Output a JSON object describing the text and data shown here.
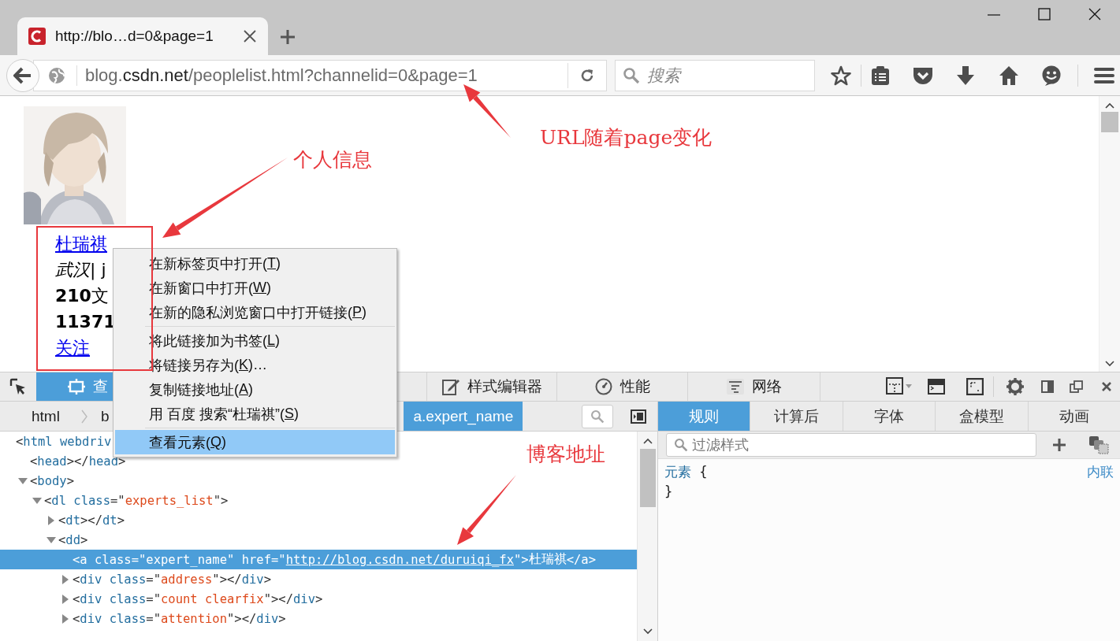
{
  "browser": {
    "tab": {
      "title": "http://blo…d=0&page=1",
      "selected": true
    },
    "address_bar": {
      "subdomain": "blog.",
      "domain": "csdn.net",
      "path": "/peoplelist.html?channelid=0&page=1"
    },
    "search": {
      "placeholder": "搜索"
    }
  },
  "page": {
    "profile": {
      "name": "杜瑞祺",
      "location": "*武汉*| j",
      "articles": "**210**文",
      "visits": "11371",
      "follow": "关注"
    }
  },
  "devtools": {
    "tabs": [
      {
        "label": "查",
        "kind": "inspector",
        "selected": true
      },
      {
        "label": "样式编辑器",
        "kind": "style-editor",
        "selected": false
      },
      {
        "label": "性能",
        "kind": "performance",
        "selected": false
      },
      {
        "label": "网络",
        "kind": "network",
        "selected": false
      }
    ],
    "breadcrumbs": [
      {
        "label": "html",
        "selected": false
      },
      {
        "label": "b",
        "selected": false
      },
      {
        "label": "a.expert_name",
        "selected": true
      }
    ],
    "markup_tree": [
      {
        "segments": [
          {
            "kind": "punct",
            "t": "<"
          },
          {
            "kind": "tag",
            "t": "html"
          },
          {
            "kind": "attr",
            "t": " webdriv"
          }
        ],
        "selected": false,
        "children": [
          {
            "segments": [
              {
                "kind": "punct",
                "t": "<"
              },
              {
                "kind": "tag",
                "t": "head"
              },
              {
                "kind": "punct",
                "t": "></"
              },
              {
                "kind": "tag",
                "t": "head"
              },
              {
                "kind": "punct",
                "t": ">"
              }
            ],
            "selected": false
          },
          {
            "segments": [
              {
                "kind": "punct",
                "t": "<"
              },
              {
                "kind": "tag",
                "t": "body"
              },
              {
                "kind": "punct",
                "t": ">"
              }
            ],
            "selected": false,
            "expanded": true,
            "children": [
              {
                "segments": [
                  {
                    "kind": "punct",
                    "t": "<"
                  },
                  {
                    "kind": "tag",
                    "t": "dl"
                  },
                  {
                    "kind": "attr",
                    "t": " class"
                  },
                  {
                    "kind": "punct",
                    "t": "=\""
                  },
                  {
                    "kind": "value",
                    "t": "experts_list"
                  },
                  {
                    "kind": "punct",
                    "t": "\">"
                  }
                ],
                "selected": false,
                "expanded": true,
                "children": [
                  {
                    "segments": [
                      {
                        "kind": "punct",
                        "t": "<"
                      },
                      {
                        "kind": "tag",
                        "t": "dt"
                      },
                      {
                        "kind": "punct",
                        "t": "></"
                      },
                      {
                        "kind": "tag",
                        "t": "dt"
                      },
                      {
                        "kind": "punct",
                        "t": ">"
                      }
                    ],
                    "selected": false,
                    "expanded": false
                  },
                  {
                    "segments": [
                      {
                        "kind": "punct",
                        "t": "<"
                      },
                      {
                        "kind": "tag",
                        "t": "dd"
                      },
                      {
                        "kind": "punct",
                        "t": ">"
                      }
                    ],
                    "selected": false,
                    "expanded": true,
                    "children": [
                      {
                        "segments": [
                          {
                            "kind": "punct",
                            "t": "<"
                          },
                          {
                            "kind": "tag",
                            "t": "a"
                          },
                          {
                            "kind": "attr",
                            "t": " class"
                          },
                          {
                            "kind": "punct",
                            "t": "=\""
                          },
                          {
                            "kind": "value",
                            "t": "expert_name"
                          },
                          {
                            "kind": "punct",
                            "t": "\""
                          },
                          {
                            "kind": "attr",
                            "t": " href"
                          },
                          {
                            "kind": "punct",
                            "t": "=\""
                          },
                          {
                            "kind": "link",
                            "t": "http://blog.csdn.net/duruiqi_fx"
                          },
                          {
                            "kind": "punct",
                            "t": "\">"
                          },
                          {
                            "kind": "text",
                            "t": "杜瑞祺"
                          },
                          {
                            "kind": "punct",
                            "t": "</"
                          },
                          {
                            "kind": "tag",
                            "t": "a"
                          },
                          {
                            "kind": "punct",
                            "t": ">"
                          }
                        ],
                        "selected": true
                      },
                      {
                        "segments": [
                          {
                            "kind": "punct",
                            "t": "<"
                          },
                          {
                            "kind": "tag",
                            "t": "div"
                          },
                          {
                            "kind": "attr",
                            "t": " class"
                          },
                          {
                            "kind": "punct",
                            "t": "=\""
                          },
                          {
                            "kind": "value",
                            "t": "address"
                          },
                          {
                            "kind": "punct",
                            "t": "\"></"
                          },
                          {
                            "kind": "tag",
                            "t": "div"
                          },
                          {
                            "kind": "punct",
                            "t": ">"
                          }
                        ],
                        "selected": false,
                        "expanded": false
                      },
                      {
                        "segments": [
                          {
                            "kind": "punct",
                            "t": "<"
                          },
                          {
                            "kind": "tag",
                            "t": "div"
                          },
                          {
                            "kind": "attr",
                            "t": " class"
                          },
                          {
                            "kind": "punct",
                            "t": "=\""
                          },
                          {
                            "kind": "value",
                            "t": "count clearfix"
                          },
                          {
                            "kind": "punct",
                            "t": "\"></"
                          },
                          {
                            "kind": "tag",
                            "t": "div"
                          },
                          {
                            "kind": "punct",
                            "t": ">"
                          }
                        ],
                        "selected": false,
                        "expanded": false
                      },
                      {
                        "segments": [
                          {
                            "kind": "punct",
                            "t": "<"
                          },
                          {
                            "kind": "tag",
                            "t": "div"
                          },
                          {
                            "kind": "attr",
                            "t": " class"
                          },
                          {
                            "kind": "punct",
                            "t": "=\""
                          },
                          {
                            "kind": "value",
                            "t": "attention"
                          },
                          {
                            "kind": "punct",
                            "t": "\"></"
                          },
                          {
                            "kind": "tag",
                            "t": "div"
                          },
                          {
                            "kind": "punct",
                            "t": ">"
                          }
                        ],
                        "selected": false,
                        "expanded": false
                      }
                    ]
                  }
                ]
              }
            ]
          }
        ]
      }
    ],
    "sidebar_tabs": [
      {
        "label": "规则",
        "selected": true
      },
      {
        "label": "计算后",
        "selected": false
      },
      {
        "label": "字体",
        "selected": false
      },
      {
        "label": "盒模型",
        "selected": false
      },
      {
        "label": "动画",
        "selected": false
      }
    ],
    "filter": {
      "placeholder": "过滤样式"
    },
    "rule": {
      "selector": "元素",
      "open_brace": "{",
      "close_brace": "}",
      "source": "内联"
    }
  },
  "context_menu": [
    {
      "kind": "item",
      "before": "在新标签页中打开(",
      "key": "T",
      "after": ")",
      "selected": false
    },
    {
      "kind": "item",
      "before": "在新窗口中打开(",
      "key": "W",
      "after": ")",
      "selected": false
    },
    {
      "kind": "item",
      "before": "在新的隐私浏览窗口中打开链接(",
      "key": "P",
      "after": ")",
      "selected": false
    },
    {
      "kind": "separator"
    },
    {
      "kind": "item",
      "before": "将此链接加为书签(",
      "key": "L",
      "after": ")",
      "selected": false
    },
    {
      "kind": "item",
      "before": "将链接另存为(",
      "key": "K",
      "after": ")…",
      "selected": false
    },
    {
      "kind": "item",
      "before": "复制链接地址(",
      "key": "A",
      "after": ")",
      "selected": false
    },
    {
      "kind": "item",
      "before": "用 百度 搜索“杜瑞祺”(",
      "key": "S",
      "after": ")",
      "selected": false
    },
    {
      "kind": "separator"
    },
    {
      "kind": "item",
      "before": "查看元素(",
      "key": "Q",
      "after": ")",
      "selected": true
    }
  ],
  "annotations": [
    {
      "text": "URL随着page变化"
    },
    {
      "text": "个人信息"
    },
    {
      "text": "博客地址"
    }
  ]
}
